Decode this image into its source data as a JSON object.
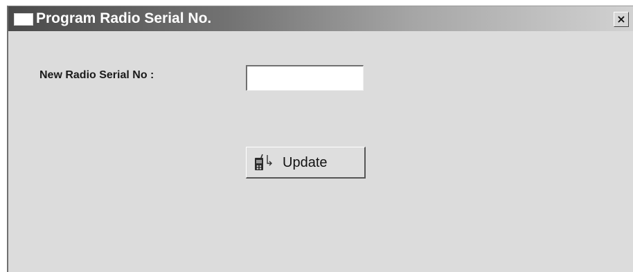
{
  "window": {
    "title": "Program Radio Serial No.",
    "close_label": "×"
  },
  "form": {
    "serial_label": "New Radio Serial No :",
    "serial_value": "",
    "serial_placeholder": ""
  },
  "actions": {
    "update_label": "Update",
    "update_icon": "radio-update-icon"
  },
  "colors": {
    "window_bg": "#dcdcdc",
    "titlebar_dark": "#4a4a4a",
    "titlebar_light": "#d2d2d2",
    "title_text": "#ffffff"
  }
}
